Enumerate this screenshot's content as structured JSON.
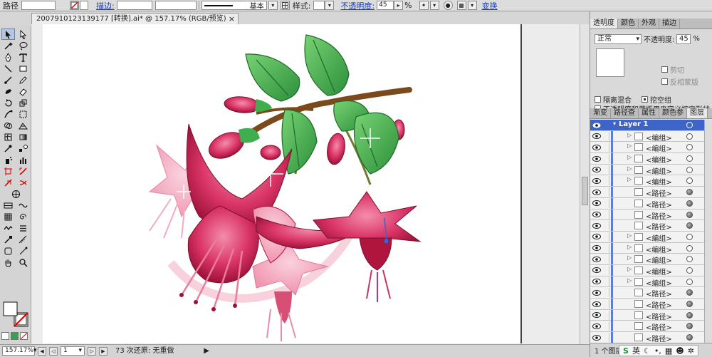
{
  "control_bar": {
    "path_label": "路径",
    "stroke_label": "描边:",
    "brush_label": "基本",
    "style_label": "样式:",
    "opacity_label": "不透明度:",
    "opacity_value": "45",
    "percent": "%",
    "transform_label": "变换"
  },
  "document": {
    "tab_title": "2007910123139177 [转换].ai* @ 157.17% (RGB/预览)",
    "close": "×"
  },
  "status_bar": {
    "zoom": "157.17%",
    "artboard": "1",
    "info": "73 次还原: 无重做"
  },
  "transparency_panel": {
    "tabs": [
      "透明度",
      "颜色",
      "外观",
      "描边"
    ],
    "blend_mode": "正常",
    "opacity_label": "不透明度:",
    "opacity_value": "45",
    "percent": "%",
    "clip_label": "剪切",
    "invert_mask_label": "反相蒙版",
    "isolate_blending_label": "隔离混合",
    "knockout_group_label": "挖空组",
    "mask_define_label": "不透明度和蒙版用来定义挖空形状"
  },
  "layers_panel": {
    "tabs": [
      "渐变",
      "路径查",
      "属性",
      "颜色参",
      "图层"
    ],
    "layer_name": "Layer 1",
    "rows": [
      "<编组>",
      "<编组>",
      "<编组>",
      "<编组>",
      "<编组>",
      "<路径>",
      "<路径>",
      "<路径>",
      "<路径>",
      "<编组>",
      "<编组>",
      "<编组>",
      "<编组>",
      "<编组>",
      "<路径>",
      "<路径>",
      "<路径>",
      "<路径>",
      "<路径>"
    ],
    "footer": "1 个图层"
  },
  "ime": {
    "lang": "英"
  },
  "colors": {
    "selection": "#3e64c8",
    "petal_dark": "#b0153e",
    "petal_light": "#f06a93",
    "leaf": "#3fae4e",
    "branch": "#7a4a1c"
  }
}
